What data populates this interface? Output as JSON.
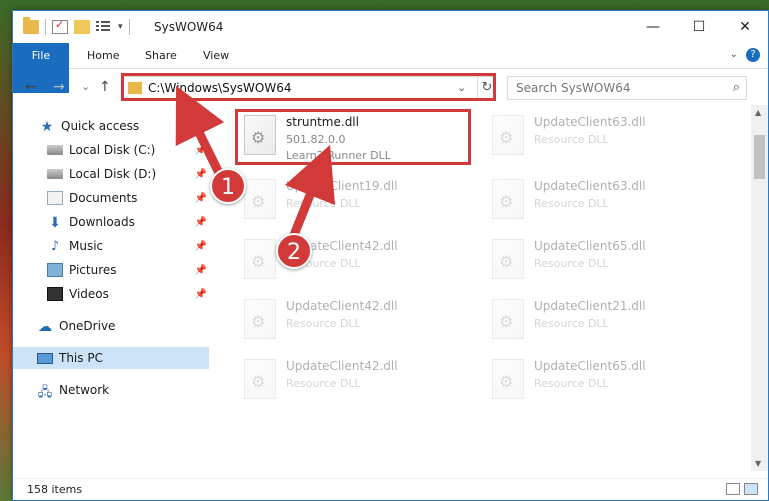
{
  "window": {
    "title": "SysWOW64",
    "controls": {
      "minimize": "—",
      "maximize": "☐",
      "close": "✕"
    }
  },
  "ribbon": {
    "tabs": [
      "File",
      "Home",
      "Share",
      "View"
    ],
    "expand_icon": "chevron-down-icon",
    "help_icon": "?"
  },
  "address_bar": {
    "path": "C:\\Windows\\SysWOW64",
    "dropdown": "⌄",
    "refresh": "↻"
  },
  "search": {
    "placeholder": "Search SysWOW64",
    "icon": "⌕"
  },
  "nav": {
    "back": "←",
    "forward": "→",
    "recent": "⌄",
    "up": "↑"
  },
  "sidebar": {
    "items": [
      {
        "label": "Quick access",
        "icon": "star-icon",
        "pinned": false
      },
      {
        "label": "Local Disk (C:)",
        "icon": "disk-icon",
        "pinned": true
      },
      {
        "label": "Local Disk (D:)",
        "icon": "disk-icon",
        "pinned": true
      },
      {
        "label": "Documents",
        "icon": "documents-icon",
        "pinned": true
      },
      {
        "label": "Downloads",
        "icon": "download-icon",
        "pinned": true
      },
      {
        "label": "Music",
        "icon": "music-icon",
        "pinned": true
      },
      {
        "label": "Pictures",
        "icon": "pictures-icon",
        "pinned": true
      },
      {
        "label": "Videos",
        "icon": "videos-icon",
        "pinned": true
      },
      {
        "label": "OneDrive",
        "icon": "cloud-icon",
        "pinned": false
      },
      {
        "label": "This PC",
        "icon": "pc-icon",
        "pinned": false,
        "selected": true
      },
      {
        "label": "Network",
        "icon": "network-icon",
        "pinned": false
      }
    ],
    "pin_glyph": "📌"
  },
  "files": {
    "highlighted": {
      "name": "struntme.dll",
      "version": "501.82.0.0",
      "type": "Learn2 Runner DLL"
    },
    "faded": [
      {
        "name": "UpdateClient63.dll",
        "type": "Resource DLL"
      },
      {
        "name": "UpdateClient19.dll",
        "type": "Resource DLL"
      },
      {
        "name": "UpdateClient63.dll",
        "type": "Resource DLL"
      },
      {
        "name": "UpdateClient42.dll",
        "type": "Resource DLL"
      },
      {
        "name": "UpdateClient65.dll",
        "type": "Resource DLL"
      },
      {
        "name": "UpdateClient42.dll",
        "type": "Resource DLL"
      },
      {
        "name": "UpdateClient21.dll",
        "type": "Resource DLL"
      },
      {
        "name": "UpdateClient42.dll",
        "type": "Resource DLL"
      },
      {
        "name": "UpdateClient65.dll",
        "type": "Resource DLL"
      }
    ]
  },
  "status": {
    "items": "158 items"
  },
  "callouts": {
    "one": "1",
    "two": "2"
  },
  "colors": {
    "accent": "#1a6cbf",
    "highlight": "#d23a3a",
    "selected": "#cde3f7"
  }
}
